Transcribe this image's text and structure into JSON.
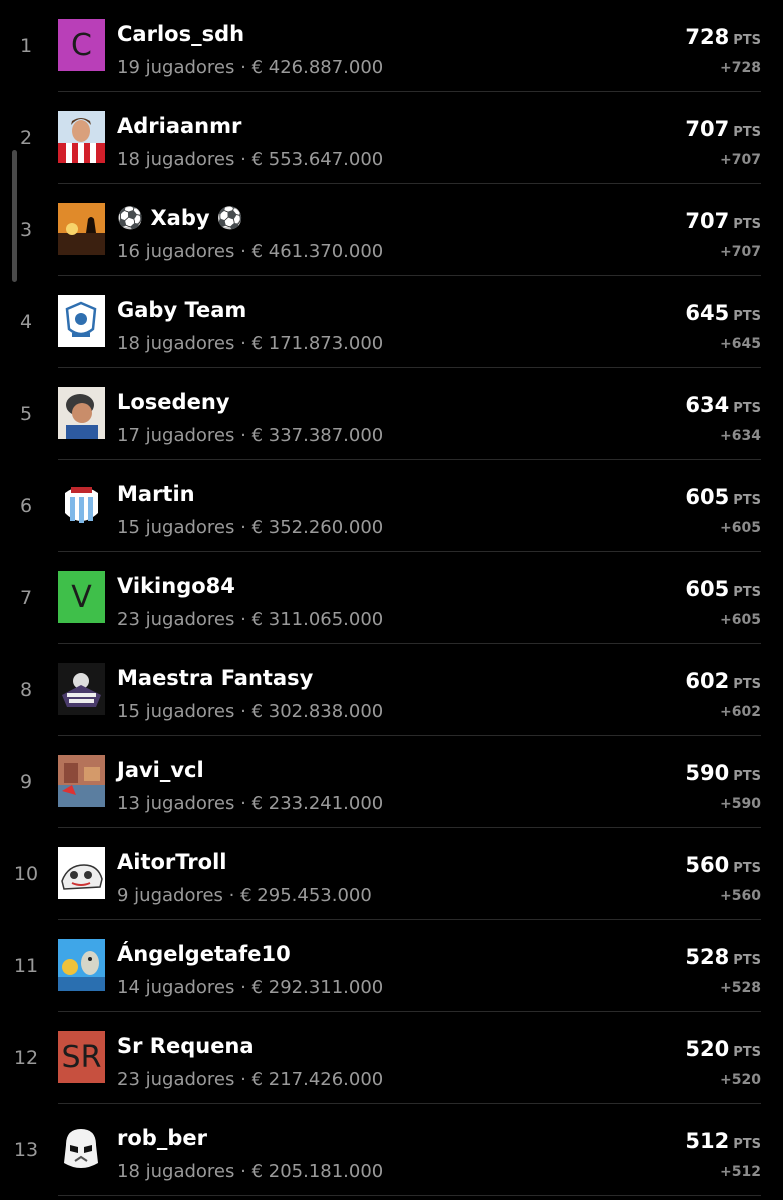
{
  "rows": [
    {
      "rank": "1",
      "name": "Carlos_sdh",
      "players": "19 jugadores",
      "value": "€ 426.887.000",
      "points": "728",
      "pts_label": "PTS",
      "delta": "+728",
      "avatar": {
        "type": "letter",
        "letter": "C",
        "color": "#b93fb8"
      }
    },
    {
      "rank": "2",
      "name": "Adriaanmr",
      "players": "18 jugadores",
      "value": "€ 553.647.000",
      "points": "707",
      "pts_label": "PTS",
      "delta": "+707",
      "avatar": {
        "type": "icon",
        "icon": "player-photo-icon"
      }
    },
    {
      "rank": "3",
      "name": "⚽ Xaby ⚽",
      "players": "16 jugadores",
      "value": "€ 461.370.000",
      "points": "707",
      "pts_label": "PTS",
      "delta": "+707",
      "avatar": {
        "type": "icon",
        "icon": "sunset-photo-icon"
      }
    },
    {
      "rank": "4",
      "name": "Gaby Team",
      "players": "18 jugadores",
      "value": "€ 171.873.000",
      "points": "645",
      "pts_label": "PTS",
      "delta": "+645",
      "avatar": {
        "type": "icon",
        "icon": "club-crest-icon"
      }
    },
    {
      "rank": "5",
      "name": "Losedeny",
      "players": "17 jugadores",
      "value": "€ 337.387.000",
      "points": "634",
      "pts_label": "PTS",
      "delta": "+634",
      "avatar": {
        "type": "icon",
        "icon": "caricature-icon"
      }
    },
    {
      "rank": "6",
      "name": "Martin",
      "players": "15 jugadores",
      "value": "€ 352.260.000",
      "points": "605",
      "pts_label": "PTS",
      "delta": "+605",
      "avatar": {
        "type": "icon",
        "icon": "striped-shield-icon"
      }
    },
    {
      "rank": "7",
      "name": "Vikingo84",
      "players": "23 jugadores",
      "value": "€ 311.065.000",
      "points": "605",
      "pts_label": "PTS",
      "delta": "+605",
      "avatar": {
        "type": "letter",
        "letter": "V",
        "color": "#3fbf4a"
      }
    },
    {
      "rank": "8",
      "name": "Maestra Fantasy",
      "players": "15 jugadores",
      "value": "€ 302.838.000",
      "points": "602",
      "pts_label": "PTS",
      "delta": "+602",
      "avatar": {
        "type": "icon",
        "icon": "fantasy-badge-icon"
      }
    },
    {
      "rank": "9",
      "name": "Javi_vcl",
      "players": "13 jugadores",
      "value": "€ 233.241.000",
      "points": "590",
      "pts_label": "PTS",
      "delta": "+590",
      "avatar": {
        "type": "icon",
        "icon": "room-photo-icon"
      }
    },
    {
      "rank": "10",
      "name": "AitorTroll",
      "players": "9 jugadores",
      "value": "€ 295.453.000",
      "points": "560",
      "pts_label": "PTS",
      "delta": "+560",
      "avatar": {
        "type": "icon",
        "icon": "cartoon-car-icon"
      }
    },
    {
      "rank": "11",
      "name": "Ángelgetafe10",
      "players": "14 jugadores",
      "value": "€ 292.311.000",
      "points": "528",
      "pts_label": "PTS",
      "delta": "+528",
      "avatar": {
        "type": "icon",
        "icon": "cartoon-scene-icon"
      }
    },
    {
      "rank": "12",
      "name": "Sr Requena",
      "players": "23 jugadores",
      "value": "€ 217.426.000",
      "points": "520",
      "pts_label": "PTS",
      "delta": "+520",
      "avatar": {
        "type": "letter",
        "letter": "SR",
        "color": "#c7503f"
      }
    },
    {
      "rank": "13",
      "name": "rob_ber",
      "players": "18 jugadores",
      "value": "€ 205.181.000",
      "points": "512",
      "pts_label": "PTS",
      "delta": "+512",
      "avatar": {
        "type": "icon",
        "icon": "stormtrooper-icon"
      }
    }
  ]
}
